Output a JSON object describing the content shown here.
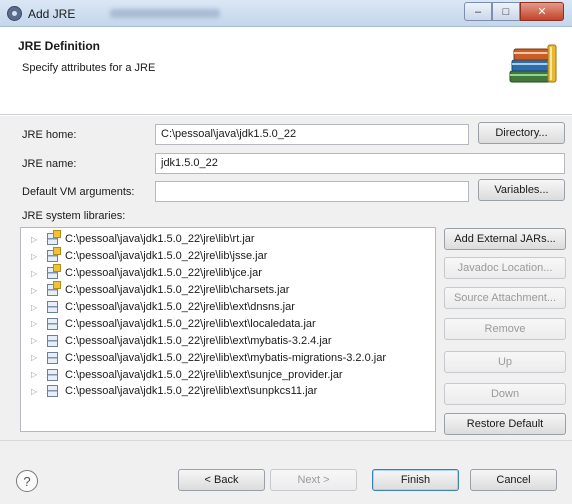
{
  "window": {
    "title": "Add JRE",
    "controls": {
      "minimize": "–",
      "maximize": "□",
      "close": "✕"
    }
  },
  "header": {
    "title": "JRE Definition",
    "description": "Specify attributes for a JRE",
    "icon": "library-books-icon"
  },
  "form": {
    "jre_home": {
      "label": "JRE home:",
      "value": "C:\\pessoal\\java\\jdk1.5.0_22",
      "button": "Directory..."
    },
    "jre_name": {
      "label": "JRE name:",
      "value": "jdk1.5.0_22"
    },
    "vm_args": {
      "label": "Default VM arguments:",
      "value": "",
      "button": "Variables..."
    },
    "libraries_label": "JRE system libraries:"
  },
  "libraries": [
    {
      "path": "C:\\pessoal\\java\\jdk1.5.0_22\\jre\\lib\\rt.jar",
      "source": true
    },
    {
      "path": "C:\\pessoal\\java\\jdk1.5.0_22\\jre\\lib\\jsse.jar",
      "source": true
    },
    {
      "path": "C:\\pessoal\\java\\jdk1.5.0_22\\jre\\lib\\jce.jar",
      "source": true
    },
    {
      "path": "C:\\pessoal\\java\\jdk1.5.0_22\\jre\\lib\\charsets.jar",
      "source": true
    },
    {
      "path": "C:\\pessoal\\java\\jdk1.5.0_22\\jre\\lib\\ext\\dnsns.jar",
      "source": false
    },
    {
      "path": "C:\\pessoal\\java\\jdk1.5.0_22\\jre\\lib\\ext\\localedata.jar",
      "source": false
    },
    {
      "path": "C:\\pessoal\\java\\jdk1.5.0_22\\jre\\lib\\ext\\mybatis-3.2.4.jar",
      "source": false
    },
    {
      "path": "C:\\pessoal\\java\\jdk1.5.0_22\\jre\\lib\\ext\\mybatis-migrations-3.2.0.jar",
      "source": false
    },
    {
      "path": "C:\\pessoal\\java\\jdk1.5.0_22\\jre\\lib\\ext\\sunjce_provider.jar",
      "source": false
    },
    {
      "path": "C:\\pessoal\\java\\jdk1.5.0_22\\jre\\lib\\ext\\sunpkcs11.jar",
      "source": false
    }
  ],
  "library_buttons": {
    "add_external": "Add External JARs...",
    "javadoc": "Javadoc Location...",
    "source": "Source Attachment...",
    "remove": "Remove",
    "up": "Up",
    "down": "Down",
    "restore": "Restore Default"
  },
  "footer": {
    "help": "?",
    "back": "< Back",
    "next": "Next >",
    "finish": "Finish",
    "cancel": "Cancel"
  }
}
